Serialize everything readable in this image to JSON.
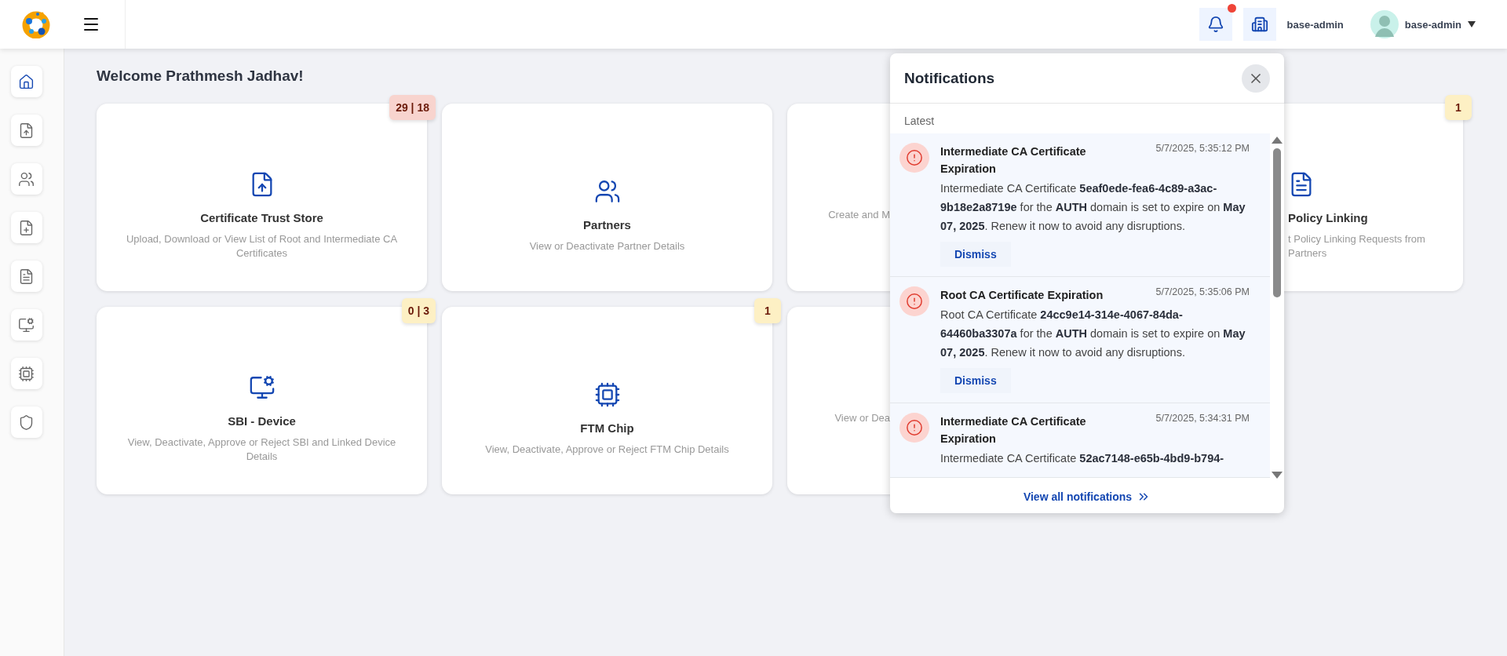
{
  "header": {
    "unread": true,
    "tenant": "base-admin",
    "user": "base-admin"
  },
  "sidebar": {
    "items": [
      {
        "kind": "home",
        "selected": true
      },
      {
        "kind": "upload",
        "selected": false
      },
      {
        "kind": "partners",
        "selected": false
      },
      {
        "kind": "policy",
        "selected": false
      },
      {
        "kind": "linking",
        "selected": false
      },
      {
        "kind": "device",
        "selected": false
      },
      {
        "kind": "chip",
        "selected": false
      },
      {
        "kind": "shield",
        "selected": false
      }
    ]
  },
  "welcome": "Welcome Prathmesh Jadhav!",
  "cards": [
    {
      "kind": "upload",
      "title": "Certificate Trust Store",
      "description": "Upload, Download or View List of Root and Intermediate CA Certificates",
      "badge": {
        "text": "29 | 18",
        "color": "#f8d4ce"
      },
      "cut_left": false,
      "cut_right": false
    },
    {
      "kind": "partners",
      "title": "Partners",
      "description": "View or Deactivate Partner Details",
      "cut_left": false,
      "cut_right": false
    },
    {
      "kind": "none",
      "description": "Create and M",
      "cut_left": false,
      "cut_right": true
    },
    {
      "kind": "linking",
      "title": "Policy Linking",
      "description": "t Policy Linking Requests from Partners",
      "badge": {
        "text": "1",
        "color": "#fdf0c4"
      },
      "cut_left": true,
      "cut_right": false
    },
    {
      "kind": "device",
      "title": "SBI - Device",
      "description": "View, Deactivate, Approve or Reject SBI and Linked Device Details",
      "badge": {
        "text": "0 | 3",
        "color": "#fdf0c4"
      },
      "cut_left": false,
      "cut_right": false
    },
    {
      "kind": "chip",
      "title": "FTM Chip",
      "description": "View, Deactivate, Approve or Reject FTM Chip Details",
      "badge": {
        "text": "1",
        "color": "#fdf0c4"
      },
      "cut_left": false,
      "cut_right": false
    },
    {
      "kind": "none",
      "description": "View or Dea",
      "cut_left": false,
      "cut_right": true
    }
  ],
  "notifications": {
    "title": "Notifications",
    "section": "Latest",
    "footer": "View all notifications",
    "items": [
      {
        "title": "Intermediate CA Certificate Expiration",
        "time": "5/7/2025, 5:35:12 PM",
        "body": "Intermediate CA Certificate **5eaf0ede-fea6-4c89-a3ac-9b18e2a8719e** for the **AUTH** domain is set to expire on **May 07, 2025**. Renew it now to avoid any disruptions.",
        "action": "Dismiss"
      },
      {
        "title": "Root CA Certificate Expiration",
        "time": "5/7/2025, 5:35:06 PM",
        "body": "Root CA Certificate **24cc9e14-314e-4067-84da-64460ba3307a** for the **AUTH** domain is set to expire on **May 07, 2025**. Renew it now to avoid any disruptions.",
        "action": "Dismiss"
      },
      {
        "title": "Intermediate CA Certificate Expiration",
        "time": "5/7/2025, 5:34:31 PM",
        "body": "Intermediate CA Certificate **52ac7148-e65b-4bd9-b794-**"
      }
    ]
  }
}
